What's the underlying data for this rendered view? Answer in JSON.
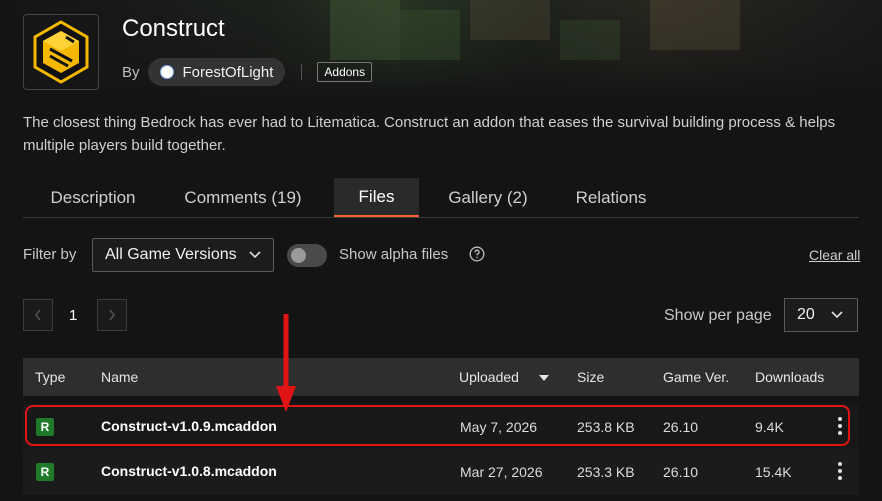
{
  "project": {
    "title": "Construct",
    "by_label": "By",
    "author": "ForestOfLight",
    "category": "Addons",
    "description": "The closest thing Bedrock has ever had to Litematica. Construct an addon that eases the survival building process & helps multiple players build together."
  },
  "tabs": [
    {
      "label": "Description",
      "active": false
    },
    {
      "label": "Comments (19)",
      "active": false
    },
    {
      "label": "Files",
      "active": true
    },
    {
      "label": "Gallery (2)",
      "active": false
    },
    {
      "label": "Relations",
      "active": false
    }
  ],
  "filters": {
    "filter_by_label": "Filter by",
    "game_version": "All Game Versions",
    "show_alpha_label": "Show alpha files",
    "show_alpha_enabled": false,
    "clear_all": "Clear all"
  },
  "pagination": {
    "current_page": "1",
    "show_per_page_label": "Show per page",
    "per_page": "20"
  },
  "table": {
    "columns": {
      "type": "Type",
      "name": "Name",
      "uploaded": "Uploaded",
      "size": "Size",
      "game_ver": "Game Ver.",
      "downloads": "Downloads"
    },
    "rows": [
      {
        "type": "R",
        "name": "Construct-v1.0.9.mcaddon",
        "uploaded": "May 7, 2026",
        "size": "253.8 KB",
        "game_ver": "26.10",
        "downloads": "9.4K"
      },
      {
        "type": "R",
        "name": "Construct-v1.0.8.mcaddon",
        "uploaded": "Mar 27, 2026",
        "size": "253.3 KB",
        "game_ver": "26.10",
        "downloads": "15.4K"
      }
    ]
  },
  "colors": {
    "accent": "#f16436",
    "release_badge": "#1f7a2a",
    "annotation": "#e01414",
    "logo_yellow": "#f5b800"
  },
  "icons": [
    "construct-logo",
    "chevron-down-icon",
    "help-circle-icon",
    "chevron-left-icon",
    "chevron-right-icon",
    "sort-down-icon",
    "kebab-menu-icon",
    "annotation-arrow"
  ]
}
